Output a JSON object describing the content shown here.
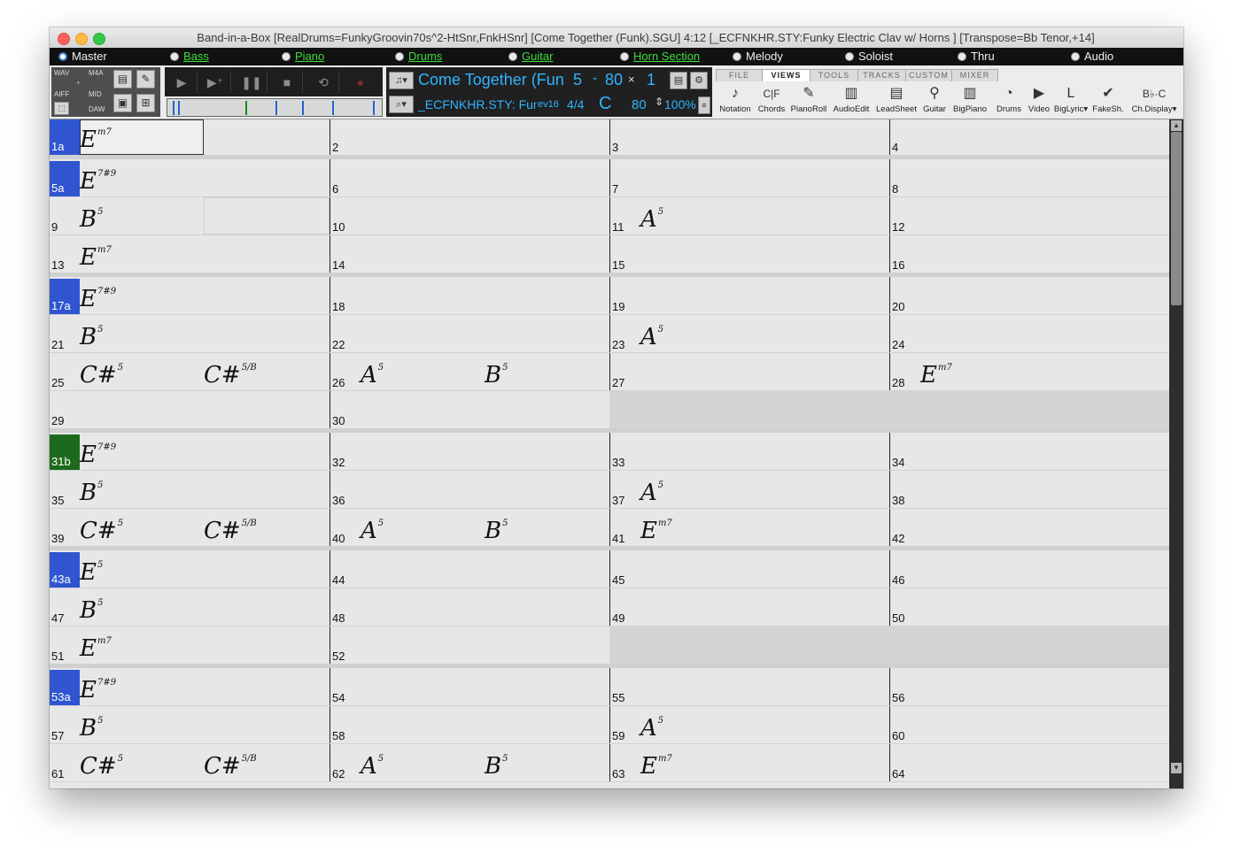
{
  "window": {
    "title": "Band-in-a-Box [RealDrums=FunkyGroovin70s^2-HtSnr,FnkHSnr] [Come Together (Funk).SGU]   4:12  [_ECFNKHR.STY:Funky Electric Clav w/ Horns ] [Transpose=Bb Tenor,+14]"
  },
  "tracks": [
    {
      "label": "Master",
      "selected": true,
      "active": false
    },
    {
      "label": "Bass",
      "selected": false,
      "active": true
    },
    {
      "label": "Piano",
      "selected": false,
      "active": true
    },
    {
      "label": "Drums",
      "selected": false,
      "active": true
    },
    {
      "label": "Guitar",
      "selected": false,
      "active": true
    },
    {
      "label": "Horn Section",
      "selected": false,
      "active": true
    },
    {
      "label": "Melody",
      "selected": false,
      "active": false
    },
    {
      "label": "Soloist",
      "selected": false,
      "active": false
    },
    {
      "label": "Thru",
      "selected": false,
      "active": false
    },
    {
      "label": "Audio",
      "selected": false,
      "active": false
    }
  ],
  "toolbar": {
    "formats": {
      "wav": "WAV",
      "m4a": "M4A",
      "aiff": "AIFF",
      "mid": "MID",
      "daw": "DAW"
    },
    "song_title": "Come Together (Funk",
    "loop_start": "5",
    "loop_dash": "-",
    "loop_end": "80",
    "loop_times": "×",
    "loop_count": "1",
    "style_name": "_ECFNKHR.STY: Fun",
    "version": "ev16",
    "time_signature": "4/4",
    "key": "C",
    "tempo": "80",
    "tempo_percent": "100%"
  },
  "menu_tabs": [
    "FILE",
    "VIEWS",
    "TOOLS",
    "TRACKS",
    "CUSTOM",
    "MIXER"
  ],
  "active_menu_tab": "VIEWS",
  "view_buttons": [
    {
      "label": "Notation",
      "icon": "note-icon"
    },
    {
      "label": "Chords",
      "icon": "chords-icon"
    },
    {
      "label": "PianoRoll",
      "icon": "pianoroll-icon"
    },
    {
      "label": "AudioEdit",
      "icon": "audioedit-icon"
    },
    {
      "label": "LeadSheet",
      "icon": "leadsheet-icon"
    },
    {
      "label": "Guitar",
      "icon": "guitar-icon"
    },
    {
      "label": "BigPiano",
      "icon": "bigpiano-icon"
    },
    {
      "label": "Drums",
      "icon": "drums-icon"
    },
    {
      "label": "Video",
      "icon": "video-icon"
    },
    {
      "label": "BigLyric▾",
      "icon": "biglyric-icon"
    },
    {
      "label": "FakeSh.",
      "icon": "fakesheet-icon"
    },
    {
      "label": "Ch.Display▾",
      "icon": "chord-display-icon"
    }
  ],
  "chord_sheet": {
    "rows": [
      {
        "bars": [
          {
            "n": "1",
            "mark": "1a",
            "chords": [
              {
                "root": "E",
                "ext": "m7",
                "pos": 0
              }
            ],
            "selected_half": true
          },
          {
            "n": "2",
            "chords": []
          },
          {
            "n": "3",
            "chords": []
          },
          {
            "n": "4",
            "chords": []
          }
        ],
        "section_end": true
      },
      {
        "bars": [
          {
            "n": "5",
            "mark": "5a",
            "chords": [
              {
                "root": "E",
                "ext": "7#9",
                "pos": 0
              }
            ]
          },
          {
            "n": "6",
            "chords": []
          },
          {
            "n": "7",
            "chords": []
          },
          {
            "n": "8",
            "chords": []
          }
        ]
      },
      {
        "bars": [
          {
            "n": "9",
            "chords": [
              {
                "root": "B",
                "ext": "5",
                "pos": 0
              }
            ],
            "outlined_half": true
          },
          {
            "n": "10",
            "chords": []
          },
          {
            "n": "11",
            "chords": [
              {
                "root": "A",
                "ext": "5",
                "pos": 0
              }
            ]
          },
          {
            "n": "12",
            "chords": []
          }
        ]
      },
      {
        "bars": [
          {
            "n": "13",
            "chords": [
              {
                "root": "E",
                "ext": "m7",
                "pos": 0
              }
            ]
          },
          {
            "n": "14",
            "chords": []
          },
          {
            "n": "15",
            "chords": []
          },
          {
            "n": "16",
            "chords": []
          }
        ],
        "section_end": true
      },
      {
        "bars": [
          {
            "n": "17",
            "mark": "17a",
            "chords": [
              {
                "root": "E",
                "ext": "7#9",
                "pos": 0
              }
            ]
          },
          {
            "n": "18",
            "chords": []
          },
          {
            "n": "19",
            "chords": []
          },
          {
            "n": "20",
            "chords": []
          }
        ]
      },
      {
        "bars": [
          {
            "n": "21",
            "chords": [
              {
                "root": "B",
                "ext": "5",
                "pos": 0
              }
            ]
          },
          {
            "n": "22",
            "chords": []
          },
          {
            "n": "23",
            "chords": [
              {
                "root": "A",
                "ext": "5",
                "pos": 0
              }
            ]
          },
          {
            "n": "24",
            "chords": []
          }
        ]
      },
      {
        "bars": [
          {
            "n": "25",
            "chords": [
              {
                "root": "C#",
                "ext": "5",
                "pos": 0
              },
              {
                "root": "C#",
                "ext": "5/B",
                "pos": 1
              }
            ]
          },
          {
            "n": "26",
            "chords": [
              {
                "root": "A",
                "ext": "5",
                "pos": 0
              },
              {
                "root": "B",
                "ext": "5",
                "pos": 1
              }
            ]
          },
          {
            "n": "27",
            "chords": []
          },
          {
            "n": "28",
            "chords": [
              {
                "root": "E",
                "ext": "m7",
                "pos": 0
              }
            ]
          }
        ]
      },
      {
        "bars": [
          {
            "n": "29",
            "chords": []
          },
          {
            "n": "30",
            "chords": []
          }
        ],
        "section_end": true
      },
      {
        "bars": [
          {
            "n": "31",
            "mark": "31b",
            "mark_color": "green",
            "chords": [
              {
                "root": "E",
                "ext": "7#9",
                "pos": 0
              }
            ]
          },
          {
            "n": "32",
            "chords": []
          },
          {
            "n": "33",
            "chords": []
          },
          {
            "n": "34",
            "chords": []
          }
        ]
      },
      {
        "bars": [
          {
            "n": "35",
            "chords": [
              {
                "root": "B",
                "ext": "5",
                "pos": 0
              }
            ]
          },
          {
            "n": "36",
            "chords": []
          },
          {
            "n": "37",
            "chords": [
              {
                "root": "A",
                "ext": "5",
                "pos": 0
              }
            ]
          },
          {
            "n": "38",
            "chords": []
          }
        ]
      },
      {
        "bars": [
          {
            "n": "39",
            "chords": [
              {
                "root": "C#",
                "ext": "5",
                "pos": 0
              },
              {
                "root": "C#",
                "ext": "5/B",
                "pos": 1
              }
            ]
          },
          {
            "n": "40",
            "chords": [
              {
                "root": "A",
                "ext": "5",
                "pos": 0
              },
              {
                "root": "B",
                "ext": "5",
                "pos": 1
              }
            ]
          },
          {
            "n": "41",
            "chords": [
              {
                "root": "E",
                "ext": "m7",
                "pos": 0
              }
            ]
          },
          {
            "n": "42",
            "chords": []
          }
        ],
        "section_end": true
      },
      {
        "bars": [
          {
            "n": "43",
            "mark": "43a",
            "chords": [
              {
                "root": "E",
                "ext": "5",
                "pos": 0
              }
            ]
          },
          {
            "n": "44",
            "chords": []
          },
          {
            "n": "45",
            "chords": []
          },
          {
            "n": "46",
            "chords": []
          }
        ]
      },
      {
        "bars": [
          {
            "n": "47",
            "chords": [
              {
                "root": "B",
                "ext": "5",
                "pos": 0
              }
            ]
          },
          {
            "n": "48",
            "chords": []
          },
          {
            "n": "49",
            "chords": []
          },
          {
            "n": "50",
            "chords": []
          }
        ]
      },
      {
        "bars": [
          {
            "n": "51",
            "chords": [
              {
                "root": "E",
                "ext": "m7",
                "pos": 0
              }
            ]
          },
          {
            "n": "52",
            "chords": []
          }
        ],
        "section_end": true
      },
      {
        "bars": [
          {
            "n": "53",
            "mark": "53a",
            "chords": [
              {
                "root": "E",
                "ext": "7#9",
                "pos": 0
              }
            ]
          },
          {
            "n": "54",
            "chords": []
          },
          {
            "n": "55",
            "chords": []
          },
          {
            "n": "56",
            "chords": []
          }
        ]
      },
      {
        "bars": [
          {
            "n": "57",
            "chords": [
              {
                "root": "B",
                "ext": "5",
                "pos": 0
              }
            ]
          },
          {
            "n": "58",
            "chords": []
          },
          {
            "n": "59",
            "chords": [
              {
                "root": "A",
                "ext": "5",
                "pos": 0
              }
            ]
          },
          {
            "n": "60",
            "chords": []
          }
        ]
      },
      {
        "bars": [
          {
            "n": "61",
            "chords": [
              {
                "root": "C#",
                "ext": "5",
                "pos": 0
              },
              {
                "root": "C#",
                "ext": "5/B",
                "pos": 1
              }
            ]
          },
          {
            "n": "62",
            "chords": [
              {
                "root": "A",
                "ext": "5",
                "pos": 0
              },
              {
                "root": "B",
                "ext": "5",
                "pos": 1
              }
            ]
          },
          {
            "n": "63",
            "chords": [
              {
                "root": "E",
                "ext": "m7",
                "pos": 0
              }
            ]
          },
          {
            "n": "64",
            "chords": []
          }
        ]
      }
    ]
  },
  "colors": {
    "rehearsal_blue": "#2f55d0",
    "rehearsal_green": "#1d6a1d",
    "active_track": "#3ddc3d",
    "song_text": "#2fb4ff"
  }
}
